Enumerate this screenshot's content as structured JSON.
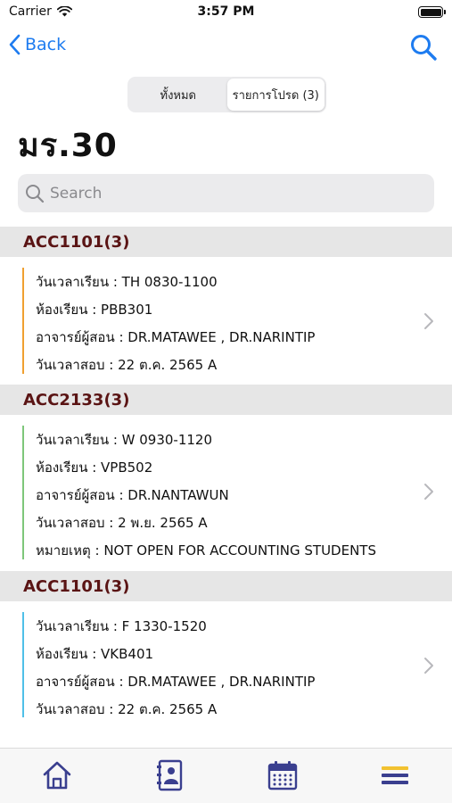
{
  "status": {
    "carrier": "Carrier",
    "time": "3:57 PM"
  },
  "nav": {
    "back_label": "Back"
  },
  "segments": [
    {
      "label": "ทั้งหมด",
      "active": false
    },
    {
      "label": "รายการโปรด (3)",
      "active": true
    }
  ],
  "page_title": "มร.30",
  "search": {
    "placeholder": "Search"
  },
  "courses": [
    {
      "code": "ACC1101(3)",
      "accent": "#f0a030",
      "lines": [
        "วันเวลาเรียน : TH 0830-1100",
        "ห้องเรียน : PBB301",
        "อาจารย์ผู้สอน : DR.MATAWEE , DR.NARINTIP",
        "วันเวลาสอบ : 22 ต.ค. 2565 A"
      ]
    },
    {
      "code": "ACC2133(3)",
      "accent": "#7ec77a",
      "lines": [
        "วันเวลาเรียน : W 0930-1120",
        "ห้องเรียน : VPB502",
        "อาจารย์ผู้สอน : DR.NANTAWUN",
        "วันเวลาสอบ : 2 พ.ย. 2565 A",
        "หมายเหตุ : NOT OPEN FOR ACCOUNTING STUDENTS"
      ]
    },
    {
      "code": "ACC1101(3)",
      "accent": "#4fc0e8",
      "lines": [
        "วันเวลาเรียน : F 1330-1520",
        "ห้องเรียน : VKB401",
        "อาจารย์ผู้สอน : DR.MATAWEE , DR.NARINTIP",
        "วันเวลาสอบ : 22 ต.ค. 2565 A"
      ]
    }
  ],
  "tabs": [
    {
      "icon": "home-icon"
    },
    {
      "icon": "contacts-book-icon"
    },
    {
      "icon": "calendar-icon"
    },
    {
      "icon": "menu-icon"
    }
  ],
  "colors": {
    "accent_blue": "#1e7cf0",
    "section_text": "#5a1414",
    "tab_icon": "#3a3f8f",
    "menu_yellow": "#f2c230"
  }
}
